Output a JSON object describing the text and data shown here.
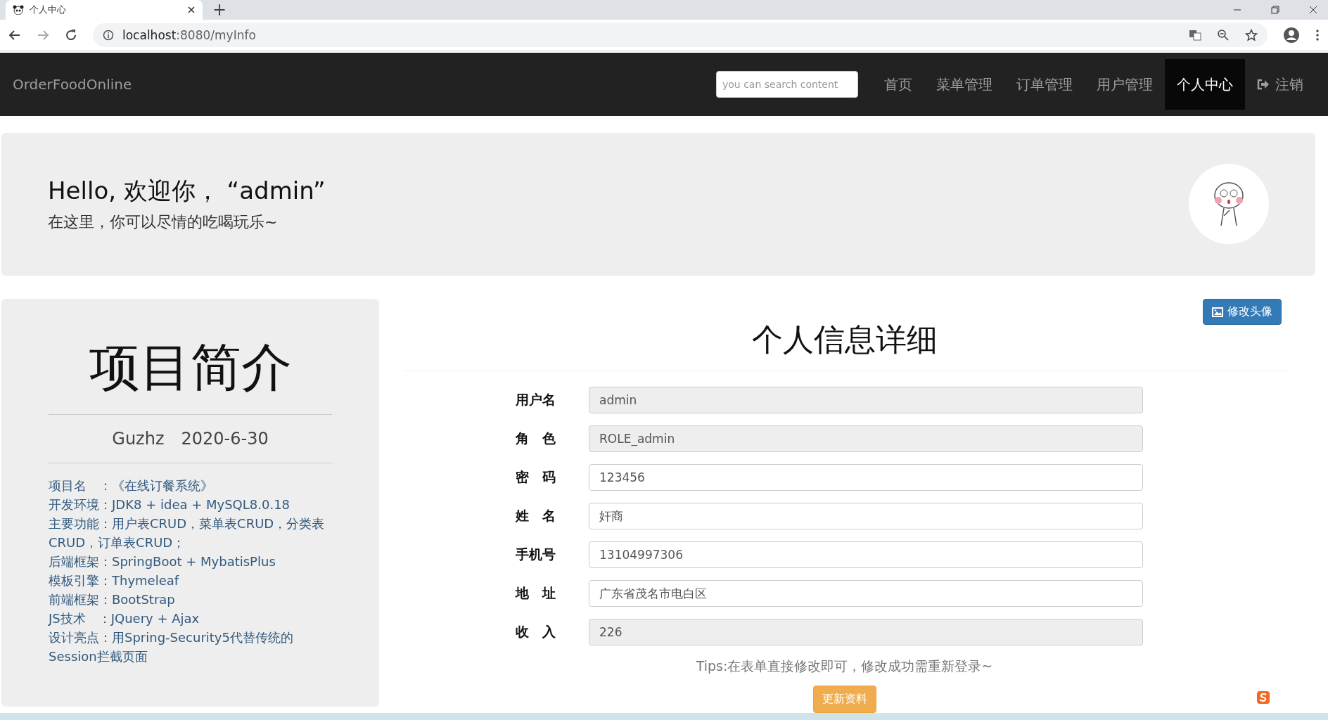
{
  "browser": {
    "tab_title": "个人中心",
    "new_tab": "+",
    "url_host": "localhost",
    "url_rest": ":8080/myInfo"
  },
  "navbar": {
    "brand": "OrderFoodOnline",
    "search": {
      "placeholder": "you can search content"
    },
    "items": [
      {
        "label": "首页",
        "selected": false
      },
      {
        "label": "菜单管理",
        "selected": false
      },
      {
        "label": "订单管理",
        "selected": false
      },
      {
        "label": "用户管理",
        "selected": false
      },
      {
        "label": "个人中心",
        "selected": true
      }
    ],
    "logout": "注销"
  },
  "banner": {
    "greeting": "Hello, 欢迎你， “admin”",
    "subtitle": "在这里，你可以尽情的吃喝玩乐~"
  },
  "project": {
    "title": "项目简介",
    "byline": "Guzhz　2020-6-30",
    "lines": [
      "项目名　：《在线订餐系统》",
      "开发环境：JDK8 + idea + MySQL8.0.18",
      "主要功能：用户表CRUD，菜单表CRUD，分类表CRUD，订单表CRUD；",
      "后端框架：SpringBoot + MybatisPlus",
      "模板引擎：Thymeleaf",
      "前端框架：BootStrap",
      "JS技术　：JQuery + Ajax",
      "设计亮点：用Spring-Security5代替传统的Session拦截页面"
    ]
  },
  "profile": {
    "avatar_button": "修改头像",
    "title": "个人信息详细",
    "fields": [
      {
        "label": "用户名",
        "value": "admin",
        "disabled": true
      },
      {
        "label": "角　色",
        "value": "ROLE_admin",
        "disabled": true
      },
      {
        "label": "密　码",
        "value": "123456",
        "disabled": false
      },
      {
        "label": "姓　名",
        "value": "奸商",
        "disabled": false
      },
      {
        "label": "手机号",
        "value": "13104997306",
        "disabled": false
      },
      {
        "label": "地　址",
        "value": "广东省茂名市电白区",
        "disabled": false
      },
      {
        "label": "收　入",
        "value": "226",
        "disabled": true
      }
    ],
    "tips": "Tips:在表单直接修改即可，修改成功需重新登录~",
    "submit": "更新资料"
  }
}
